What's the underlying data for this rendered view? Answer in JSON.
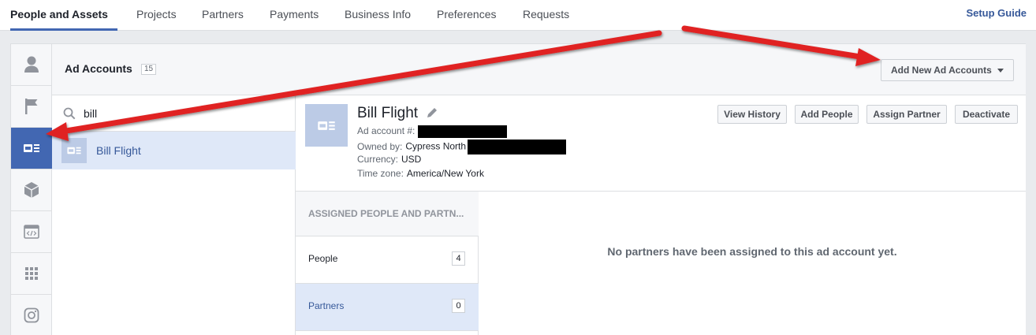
{
  "topnav": {
    "tabs": [
      "People and Assets",
      "Projects",
      "Partners",
      "Payments",
      "Business Info",
      "Preferences",
      "Requests"
    ],
    "setup_guide": "Setup Guide"
  },
  "rail": {
    "icons": [
      "person-icon",
      "flag-icon",
      "ad-account-icon",
      "box-icon",
      "code-icon",
      "apps-grid-icon",
      "instagram-icon"
    ],
    "active": "ad-account-icon",
    "accent": "#4267b2"
  },
  "header": {
    "title": "Ad Accounts",
    "count": "15",
    "add_button": "Add New Ad Accounts"
  },
  "search": {
    "value": "bill"
  },
  "list": {
    "items": [
      {
        "name": "Bill Flight"
      }
    ]
  },
  "detail": {
    "name": "Bill Flight",
    "ad_account_label": "Ad account #:",
    "owned_by_label": "Owned by:",
    "owned_by_value": "Cypress North",
    "currency_label": "Currency:",
    "currency_value": "USD",
    "timezone_label": "Time zone:",
    "timezone_value": "America/New York",
    "actions": [
      "View History",
      "Add People",
      "Assign Partner",
      "Deactivate"
    ]
  },
  "assigned": {
    "header": "ASSIGNED PEOPLE AND PARTN...",
    "items": [
      {
        "label": "People",
        "count": "4"
      },
      {
        "label": "Partners",
        "count": "0"
      }
    ],
    "empty_message": "No partners have been assigned to this ad account yet."
  },
  "annotation": {
    "arrow_color": "#e02020"
  }
}
